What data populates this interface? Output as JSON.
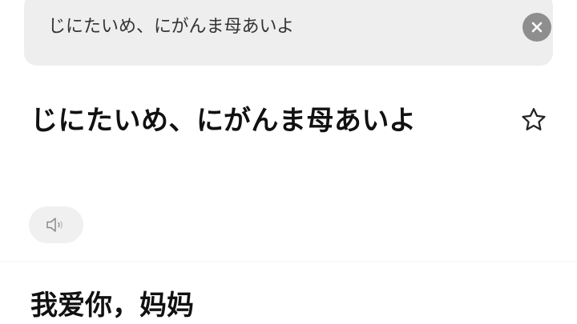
{
  "search": {
    "value": "じにたいめ、にがんま母あいよ",
    "clear_icon": "close-circle-icon"
  },
  "result": {
    "source_text": "じにたいめ、にがんま母あいよ",
    "favorite_icon": "star-outline-icon",
    "audio_icon": "speaker-icon",
    "translation": "我爱你，妈妈"
  },
  "colors": {
    "search_bg": "#eeeeee",
    "clear_icon_bg": "#8e8e8e",
    "audio_bg": "#f0f0f0",
    "text": "#111111"
  }
}
